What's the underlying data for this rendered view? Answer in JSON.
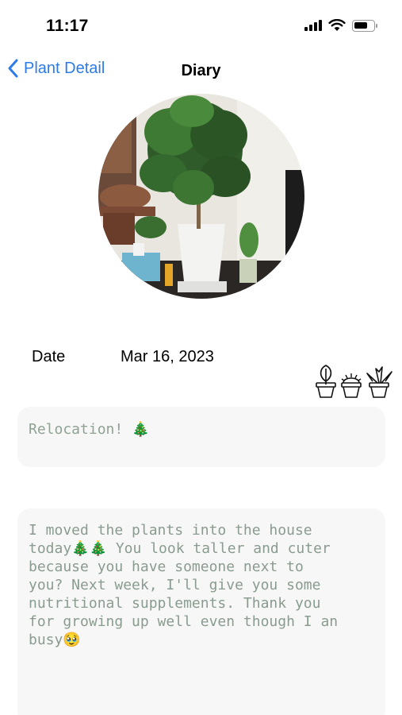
{
  "status_bar": {
    "time": "11:17",
    "icons": [
      "cellular-signal-icon",
      "wifi-icon",
      "battery-icon"
    ]
  },
  "nav": {
    "back_label": "Plant Detail",
    "title": "Diary"
  },
  "photo": {
    "subject": "potted-plant-photo"
  },
  "date": {
    "label": "Date",
    "value": "Mar 16, 2023"
  },
  "plant_icons": [
    "sprout-pot-icon",
    "cactus-pot-icon",
    "succulent-pot-icon"
  ],
  "entry": {
    "title": "Relocation! 🎄",
    "body": "I moved the plants into the house\ntoday🎄🎄 You look taller and cuter\nbecause you have someone next to\nyou? Next week, I'll give you some\nnutritional supplements. Thank you\nfor growing up well even though I an\nbusy🥹"
  },
  "colors": {
    "accent": "#2d7be8",
    "field_background": "#f6f7f6",
    "field_text": "#8a9b8f"
  }
}
